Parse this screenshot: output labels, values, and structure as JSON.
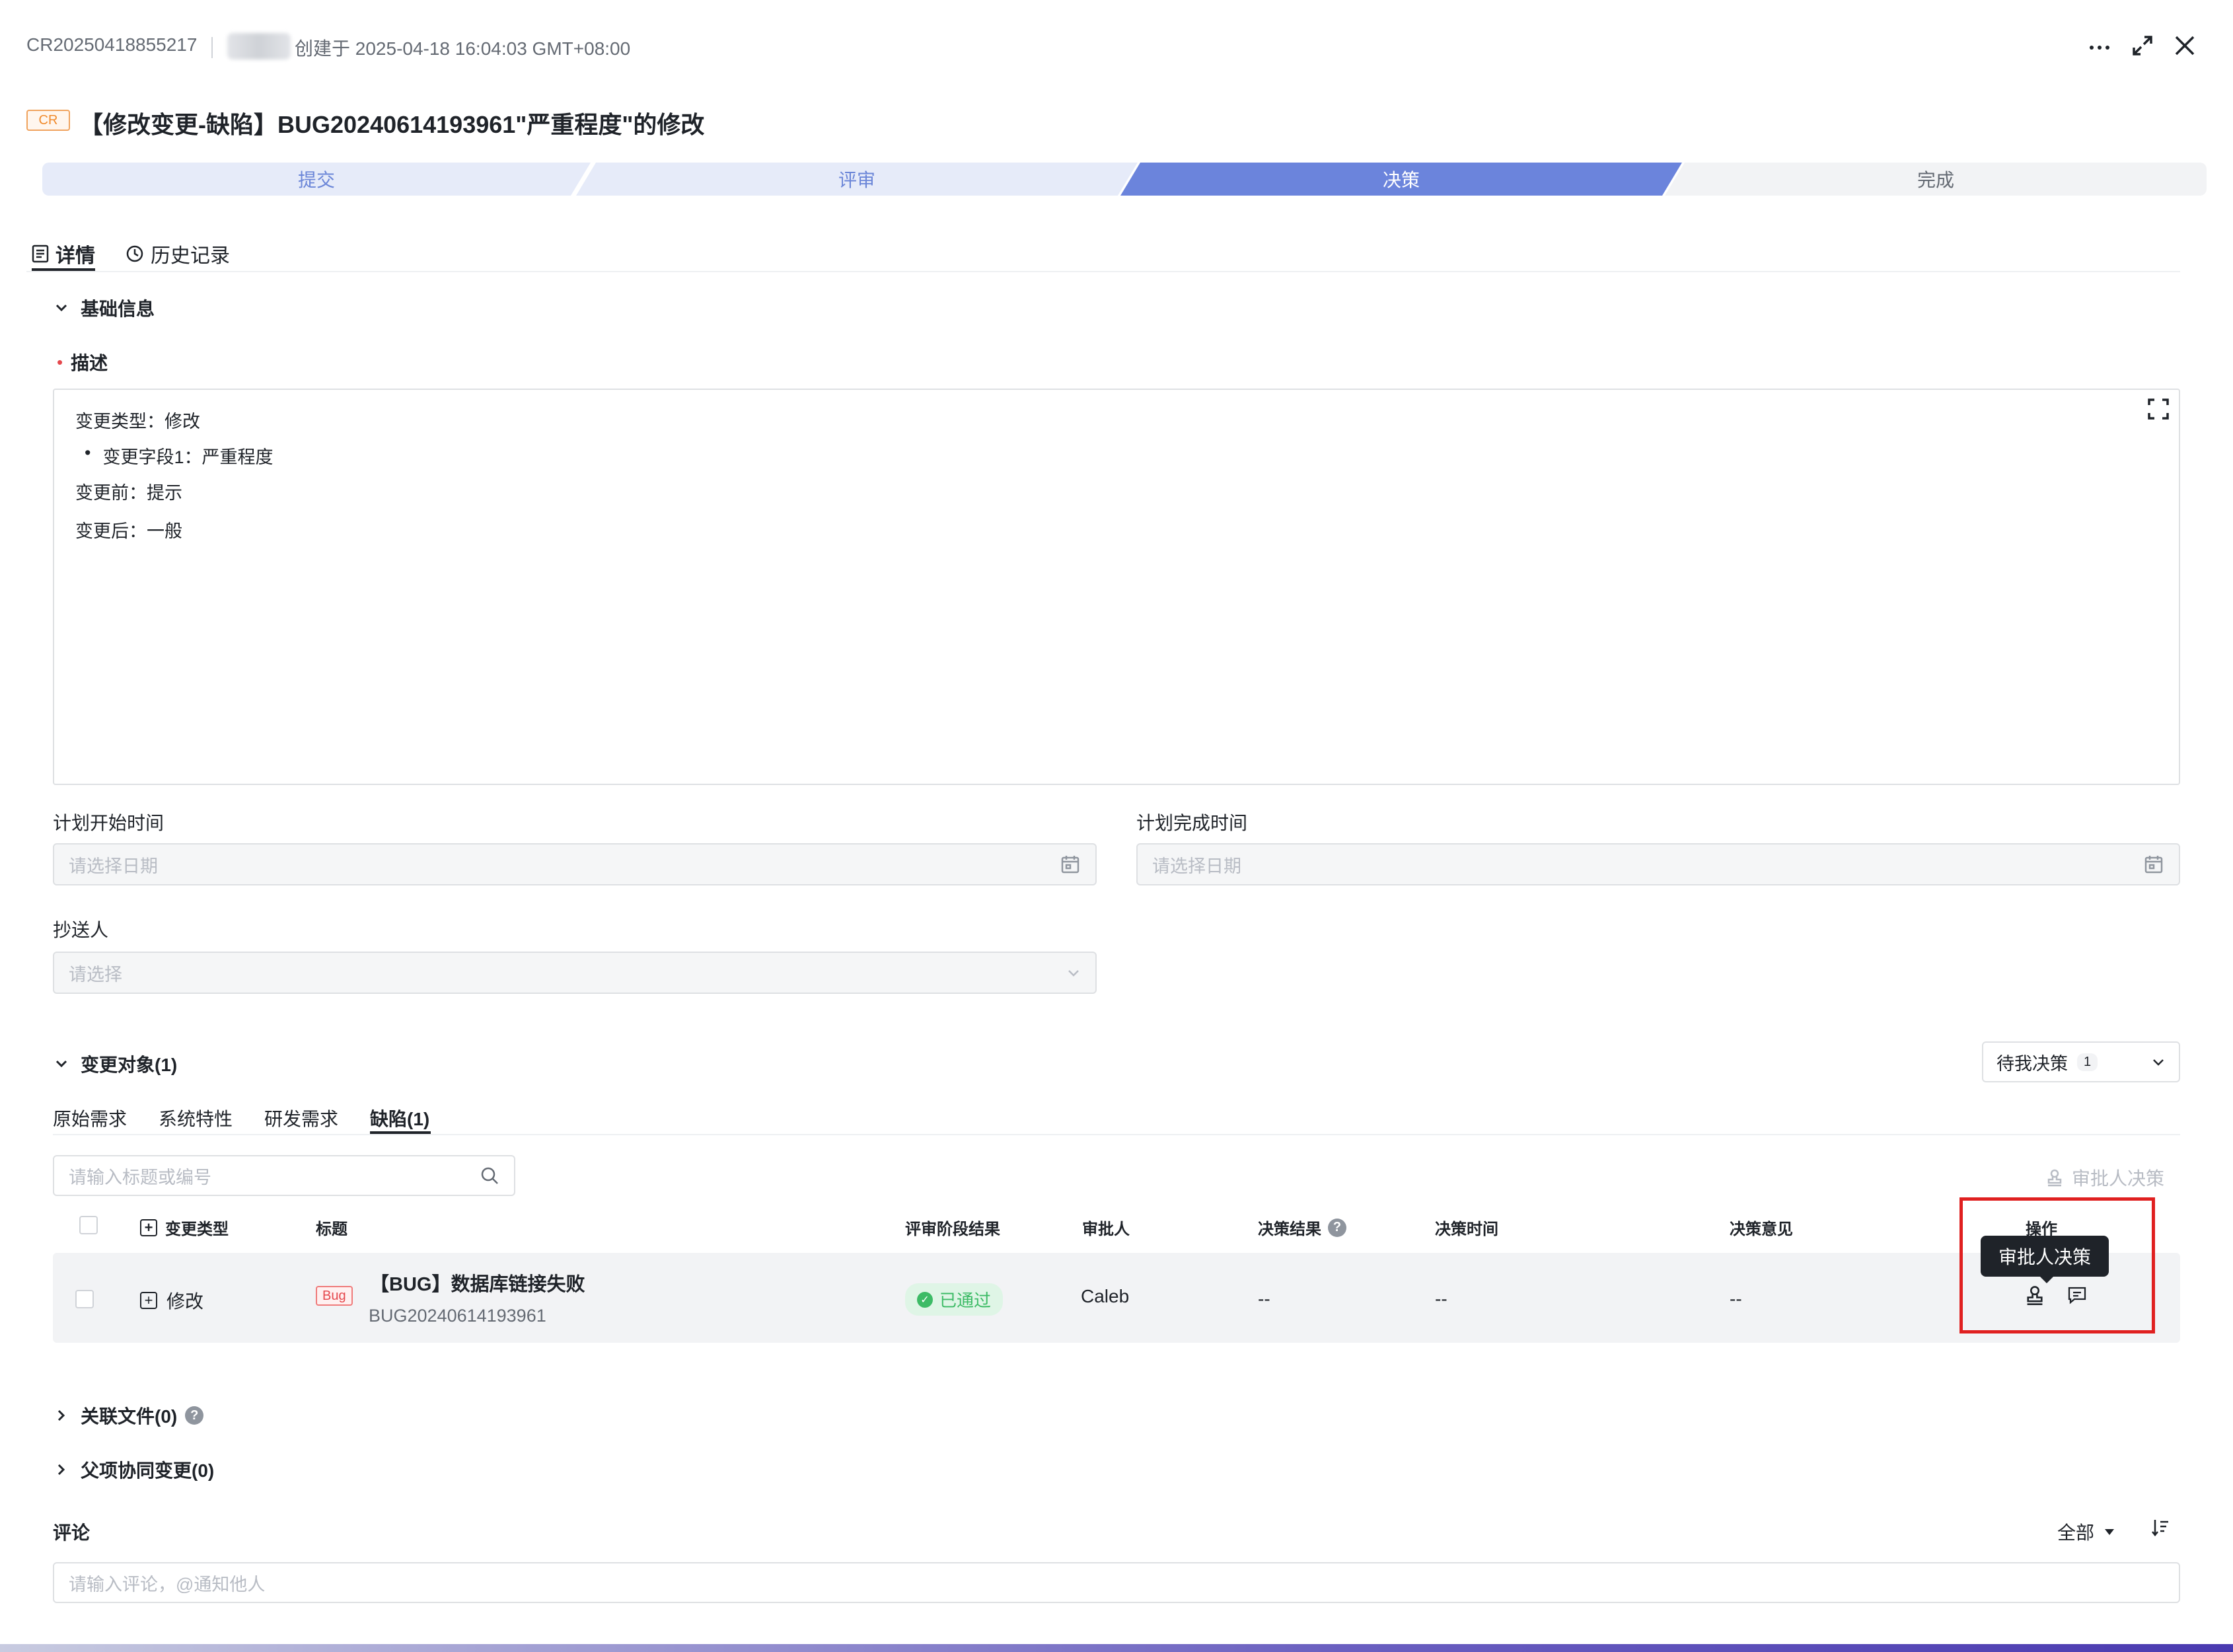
{
  "header": {
    "record_id": "CR20250418855217",
    "created_text": "创建于 2025-04-18 16:04:03 GMT+08:00",
    "tag": "CR",
    "title": "【修改变更-缺陷】BUG20240614193961\"严重程度\"的修改",
    "more_icon": "more-horizontal-icon",
    "expand_icon": "expand-icon",
    "close_icon": "close-icon"
  },
  "steps": [
    {
      "label": "提交"
    },
    {
      "label": "评审"
    },
    {
      "label": "决策"
    },
    {
      "label": "完成"
    }
  ],
  "tabs": [
    {
      "label": "详情",
      "icon": "document-icon"
    },
    {
      "label": "历史记录",
      "icon": "clock-icon"
    }
  ],
  "basic_info": {
    "title": "基础信息",
    "desc_label": "描述",
    "desc_lines": [
      "变更类型：修改",
      "变更字段1：严重程度",
      "变更前：提示",
      "变更后：一般"
    ],
    "plan_start_label": "计划开始时间",
    "plan_start_placeholder": "请选择日期",
    "plan_end_label": "计划完成时间",
    "plan_end_placeholder": "请选择日期",
    "cc_label": "抄送人",
    "cc_placeholder": "请选择"
  },
  "change_objects": {
    "title": "变更对象(1)",
    "filter_label": "待我决策",
    "filter_count": "1",
    "subtabs": [
      "原始需求",
      "系统特性",
      "研发需求",
      "缺陷(1)"
    ],
    "search_placeholder": "请输入标题或编号",
    "approve_button": "审批人决策",
    "columns": [
      "变更类型",
      "标题",
      "评审阶段结果",
      "审批人",
      "决策结果",
      "决策时间",
      "决策意见",
      "操作"
    ],
    "rows": [
      {
        "change_type": "修改",
        "tag": "Bug",
        "title": "【BUG】数据库链接失败",
        "code": "BUG20240614193961",
        "review_result": "已通过",
        "approver": "Caleb",
        "decision_result": "--",
        "decision_time": "--",
        "decision_comment": "--"
      }
    ],
    "tooltip": "审批人决策"
  },
  "related_files": {
    "title": "关联文件(0)"
  },
  "parent_changes": {
    "title": "父项协同变更(0)"
  },
  "comments": {
    "title": "评论",
    "filter": "全部",
    "placeholder": "请输入评论，@通知他人"
  }
}
